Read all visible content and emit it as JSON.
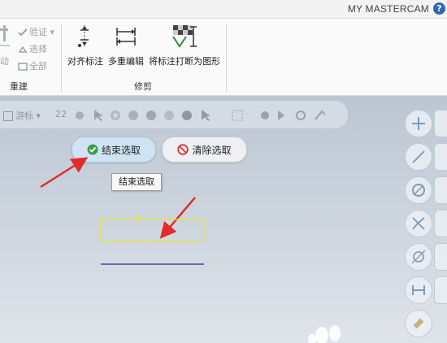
{
  "titlebar": {
    "title": "MY MASTERCAM",
    "help_glyph": "?"
  },
  "ribbon": {
    "left_small_items": [
      {
        "label": "验证",
        "icon": "verify-icon"
      },
      {
        "label": "选择",
        "icon": "select-icon"
      },
      {
        "label": "全部",
        "icon": "all-icon"
      }
    ],
    "left_partial_label": "动",
    "group_rebuild_label": "重建",
    "big_buttons": [
      {
        "label": "对齐标注",
        "icon": "align-dimension-icon"
      },
      {
        "label": "多重编辑",
        "icon": "multi-edit-icon"
      },
      {
        "label": "将标注打断为图形",
        "icon": "break-dimension-icon"
      }
    ],
    "group_trim_label": "修剪"
  },
  "viewport": {
    "toolbar": {
      "cursor_label": "游标",
      "number_label": "22"
    },
    "end_select_button": "结束选取",
    "clear_select_button": "清除选取",
    "tooltip": "结束选取",
    "colors": {
      "arrow": "#e22b2b",
      "selection_box": "#e8e43a",
      "dimension_line": "#1f2e8f"
    }
  }
}
